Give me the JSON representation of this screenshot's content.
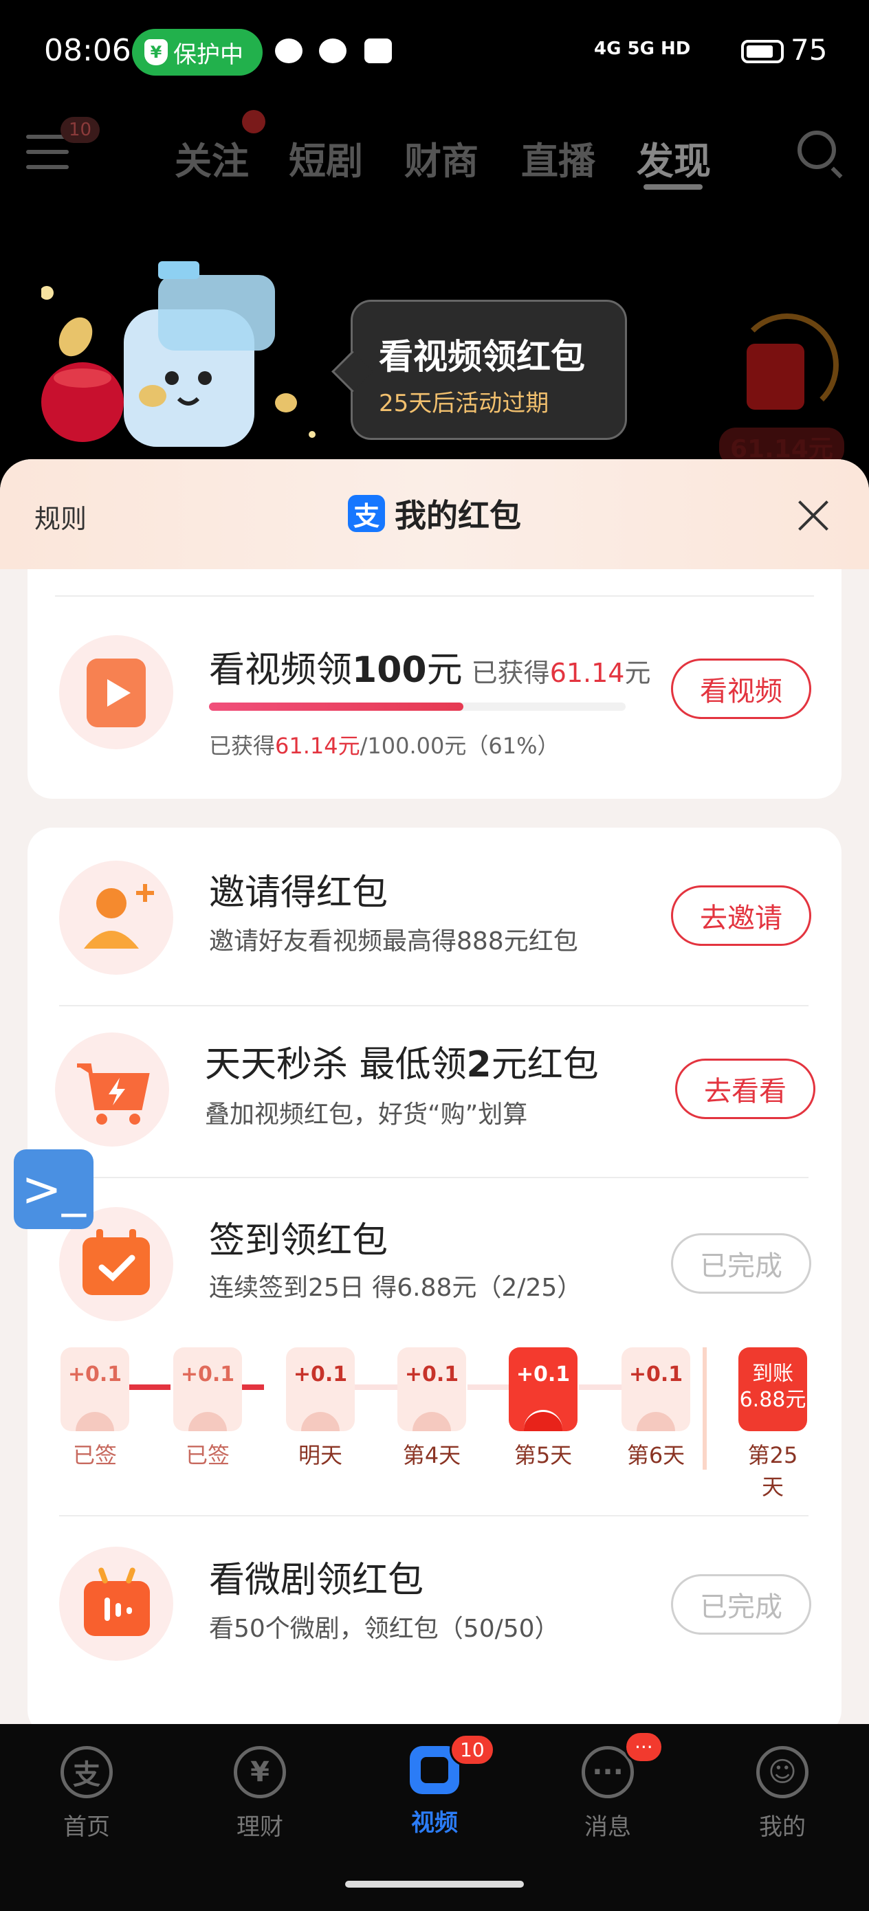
{
  "status_bar": {
    "time": "08:06",
    "protect_label": "保护中",
    "network": "4G 5G HD",
    "battery": "75"
  },
  "top_nav": {
    "menu_badge": "10",
    "tabs": [
      {
        "label": "关注"
      },
      {
        "label": "短剧"
      },
      {
        "label": "财商"
      },
      {
        "label": "直播"
      },
      {
        "label": "发现"
      }
    ],
    "active_tab": "发现"
  },
  "banner": {
    "title": "看视频领红包",
    "subtitle": "25天后活动过期",
    "right_amount": "61.14元"
  },
  "sheet": {
    "rules_label": "规则",
    "title": "我的红包",
    "watch": {
      "title_a": "看视频领",
      "title_b": "100",
      "title_c": "元",
      "earned_prefix": "已获得",
      "earned_value": "61.14",
      "earned_unit": "元",
      "progress": 0.61,
      "detail_prefix": "已获得",
      "detail_value": "61.14元",
      "detail_suffix": "/100.00元（61%）",
      "button": "看视频"
    },
    "tasks": [
      {
        "title": "邀请得红包",
        "subtitle": "邀请好友看视频最高得888元红包",
        "button": "去邀请",
        "done": false
      },
      {
        "title_a": "天天秒杀 最低领",
        "title_b": "2",
        "title_c": "元红包",
        "subtitle": "叠加视频红包，好货“购”划算",
        "button": "去看看",
        "done": false
      },
      {
        "title": "签到领红包",
        "subtitle": "连续签到25日 得6.88元（2/25）",
        "button": "已完成",
        "done": true
      },
      {
        "title": "看微剧领红包",
        "subtitle": "看50个微剧，领红包（50/50）",
        "button": "已完成",
        "done": true
      }
    ],
    "signin_days": [
      {
        "amount": "+0.1",
        "label": "已签"
      },
      {
        "amount": "+0.1",
        "label": "已签"
      },
      {
        "amount": "+0.1",
        "label": "明天"
      },
      {
        "amount": "+0.1",
        "label": "第4天"
      },
      {
        "amount": "+0.1",
        "label": "第5天"
      },
      {
        "amount": "+0.1",
        "label": "第6天"
      },
      {
        "amount_line1": "到账",
        "amount_line2": "6.88元",
        "label": "第25天"
      }
    ]
  },
  "bottom_tabs": [
    {
      "label": "首页",
      "icon": "alipay-home-icon"
    },
    {
      "label": "理财",
      "icon": "yuan-icon"
    },
    {
      "label": "视频",
      "icon": "video-icon",
      "badge": "10"
    },
    {
      "label": "消息",
      "icon": "chat-icon",
      "badge": "···"
    },
    {
      "label": "我的",
      "icon": "profile-icon"
    }
  ]
}
